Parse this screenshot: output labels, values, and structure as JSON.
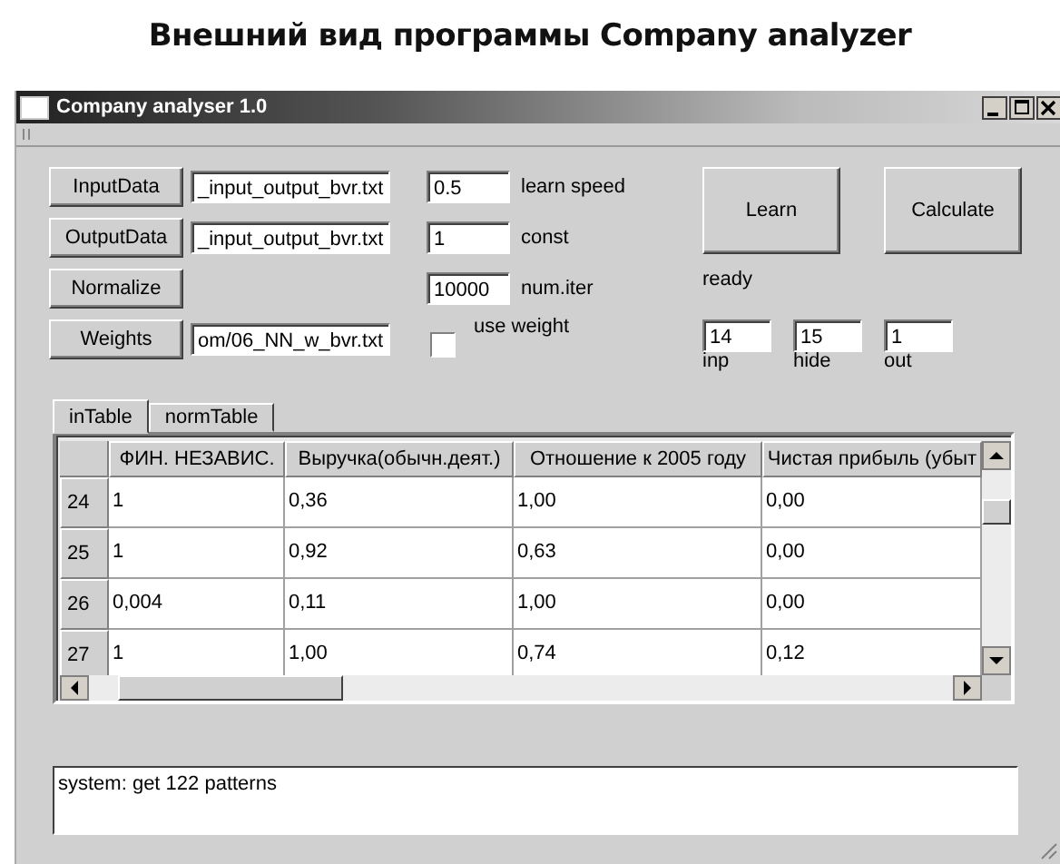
{
  "heading": "Внешний вид программы Company analyzer",
  "window": {
    "title": "Company analyser 1.0"
  },
  "file_rows": [
    {
      "button": "InputData",
      "file": "_input_output_bvr.txt"
    },
    {
      "button": "OutputData",
      "file": "_input_output_bvr.txt"
    },
    {
      "button": "Normalize"
    },
    {
      "button": "Weights",
      "file": "om/06_NN_w_bvr.txt"
    }
  ],
  "params": [
    {
      "value": "0.5",
      "label": "learn speed"
    },
    {
      "value": "1",
      "label": "const"
    },
    {
      "value": "10000",
      "label": "num.iter"
    }
  ],
  "use_weight": {
    "label": "use weight",
    "checked": false
  },
  "actions": [
    "Learn",
    "Calculate"
  ],
  "status": "ready",
  "layers": [
    {
      "value": "14",
      "label": "inp"
    },
    {
      "value": "15",
      "label": "hide"
    },
    {
      "value": "1",
      "label": "out"
    }
  ],
  "tabs": [
    {
      "label": "inTable",
      "selected": true
    },
    {
      "label": "normTable",
      "selected": false
    }
  ],
  "table": {
    "columns": [
      "ФИН. НЕЗАВИС.",
      "Выручка(обычн.деят.)",
      "Отношение к 2005 году",
      "Чистая прибыль (убыт"
    ],
    "rows": [
      {
        "index": "24",
        "cells": [
          "1",
          "0,36",
          "1,00",
          "0,00"
        ]
      },
      {
        "index": "25",
        "cells": [
          "1",
          "0,92",
          "0,63",
          "0,00"
        ]
      },
      {
        "index": "26",
        "cells": [
          "0,004",
          "0,11",
          "1,00",
          "0,00"
        ]
      },
      {
        "index": "27",
        "cells": [
          "1",
          "1,00",
          "0,74",
          "0,12"
        ]
      }
    ]
  },
  "log": "system: get 122 patterns"
}
